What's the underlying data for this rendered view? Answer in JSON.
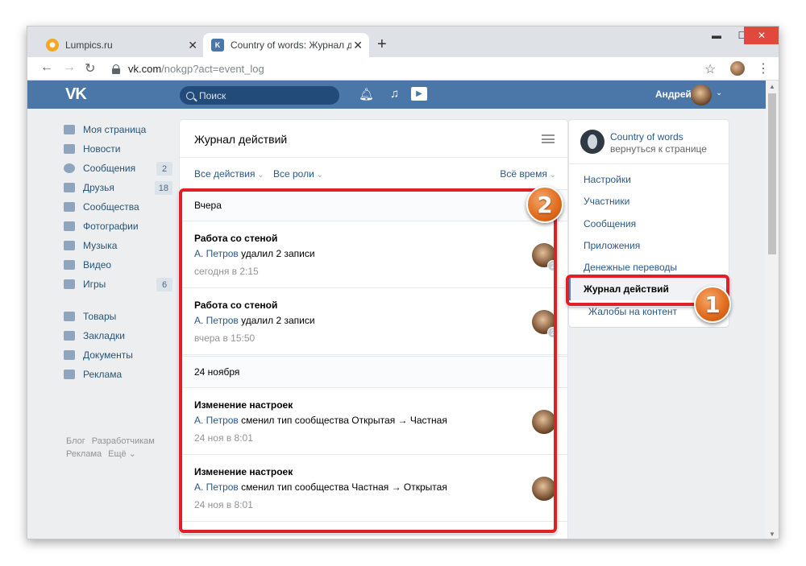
{
  "browser": {
    "tabs": [
      {
        "title": "Lumpics.ru",
        "favicon": "lumpics-favicon",
        "active": false
      },
      {
        "title": "Country of words: Журнал дейст",
        "favicon": "vk-favicon",
        "active": true
      }
    ],
    "url_host": "vk.com",
    "url_path": "/nokgp?act=event_log"
  },
  "vk_header": {
    "logo": "VK",
    "search_placeholder": "Поиск",
    "user_name": "Андрей",
    "brand_color": "#4a76a8"
  },
  "left_nav": {
    "items": [
      {
        "label": "Моя страница",
        "icon": "home-icon",
        "count": ""
      },
      {
        "label": "Новости",
        "icon": "news-icon",
        "count": ""
      },
      {
        "label": "Сообщения",
        "icon": "messages-icon",
        "count": "2"
      },
      {
        "label": "Друзья",
        "icon": "friends-icon",
        "count": "18"
      },
      {
        "label": "Сообщества",
        "icon": "groups-icon",
        "count": ""
      },
      {
        "label": "Фотографии",
        "icon": "camera-icon",
        "count": ""
      },
      {
        "label": "Музыка",
        "icon": "music-icon",
        "count": ""
      },
      {
        "label": "Видео",
        "icon": "video-icon",
        "count": ""
      },
      {
        "label": "Игры",
        "icon": "games-icon",
        "count": "6"
      }
    ],
    "items2": [
      {
        "label": "Товары",
        "icon": "shopping-bag-icon"
      },
      {
        "label": "Закладки",
        "icon": "star-icon"
      },
      {
        "label": "Документы",
        "icon": "document-icon"
      },
      {
        "label": "Реклама",
        "icon": "megaphone-icon"
      }
    ],
    "footer": [
      "Блог",
      "Разработчикам",
      "Реклама",
      "Ещё ⌄"
    ]
  },
  "main": {
    "title": "Журнал действий",
    "filters": {
      "actions": "Все действия",
      "roles": "Все роли",
      "time": "Всё время"
    },
    "sections": [
      {
        "header": "Вчера",
        "entries": [
          {
            "title": "Работа со стеной",
            "user": "А. Петров",
            "action": "удалил 2 записи",
            "time": "сегодня в 2:15",
            "badge": "2"
          },
          {
            "title": "Работа со стеной",
            "user": "А. Петров",
            "action": "удалил 2 записи",
            "time": "вчера в 15:50",
            "badge": "2"
          }
        ]
      },
      {
        "header": "24 ноября",
        "entries": [
          {
            "title": "Изменение настроек",
            "user": "А. Петров",
            "action": "сменил тип сообщества Открытая → Частная",
            "time": "24 ноя в 8:01",
            "badge": ""
          },
          {
            "title": "Изменение настроек",
            "user": "А. Петров",
            "action": "сменил тип сообщества Частная → Открытая",
            "time": "24 ноя в 8:01",
            "badge": ""
          }
        ]
      }
    ]
  },
  "right_panel": {
    "group_name": "Country of words",
    "back_link": "вернуться к странице",
    "menu": [
      "Настройки",
      "Участники",
      "Сообщения",
      "Приложения",
      "Денежные переводы",
      "Журнал действий",
      "Жалобы на контент"
    ],
    "active_item": "Журнал действий"
  },
  "annotations": {
    "marker_1": "1",
    "marker_2": "2",
    "highlight_color": "#e01f26"
  }
}
